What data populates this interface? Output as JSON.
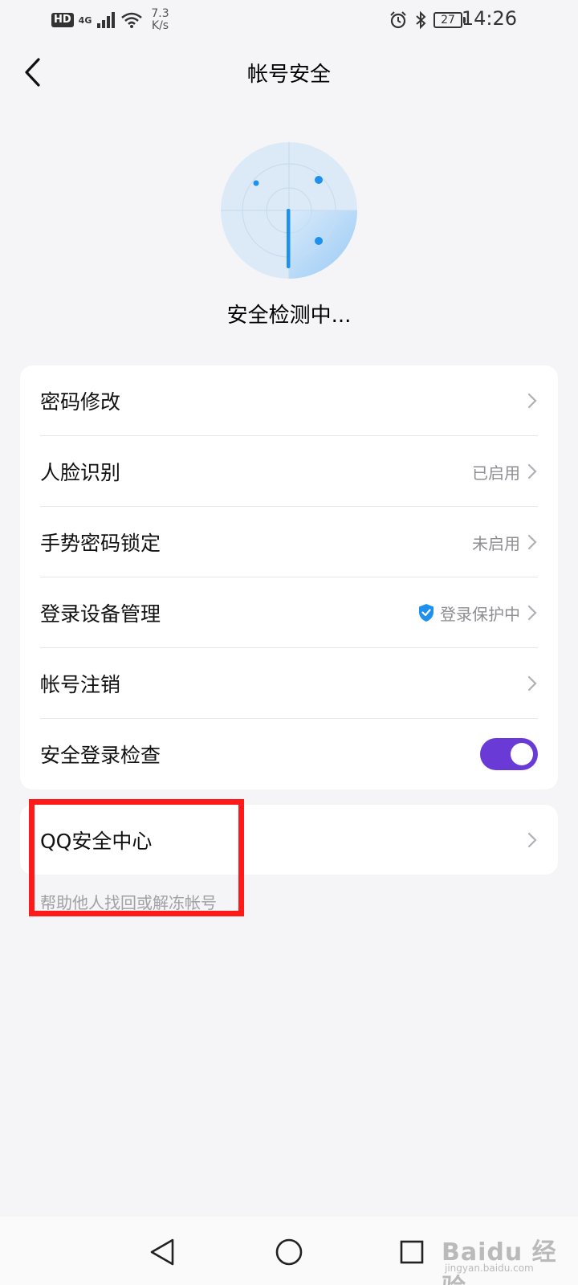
{
  "status_bar": {
    "hd_badge": "HD",
    "network_type": "4G",
    "net_speed_value": "7.3",
    "net_speed_unit": "K/s",
    "battery_level": "27",
    "time": "14:26"
  },
  "header": {
    "title": "帐号安全"
  },
  "scan": {
    "status_text": "安全检测中..."
  },
  "settings": {
    "items": [
      {
        "label": "密码修改",
        "status": ""
      },
      {
        "label": "人脸识别",
        "status": "已启用"
      },
      {
        "label": "手势密码锁定",
        "status": "未启用"
      },
      {
        "label": "登录设备管理",
        "status": "登录保护中"
      },
      {
        "label": "帐号注销",
        "status": ""
      },
      {
        "label": "安全登录检查",
        "toggle_on": true
      }
    ]
  },
  "qq_center": {
    "label": "QQ安全中心",
    "note": "帮助他人找回或解冻帐号"
  },
  "watermark": {
    "main": "Baidu 经验",
    "sub": "jingyan.baidu.com"
  },
  "colors": {
    "accent_blue": "#1e90ee",
    "toggle_purple": "#6a3ad7",
    "highlight_red": "#ff1a1a",
    "page_bg": "#f5f5f7"
  }
}
